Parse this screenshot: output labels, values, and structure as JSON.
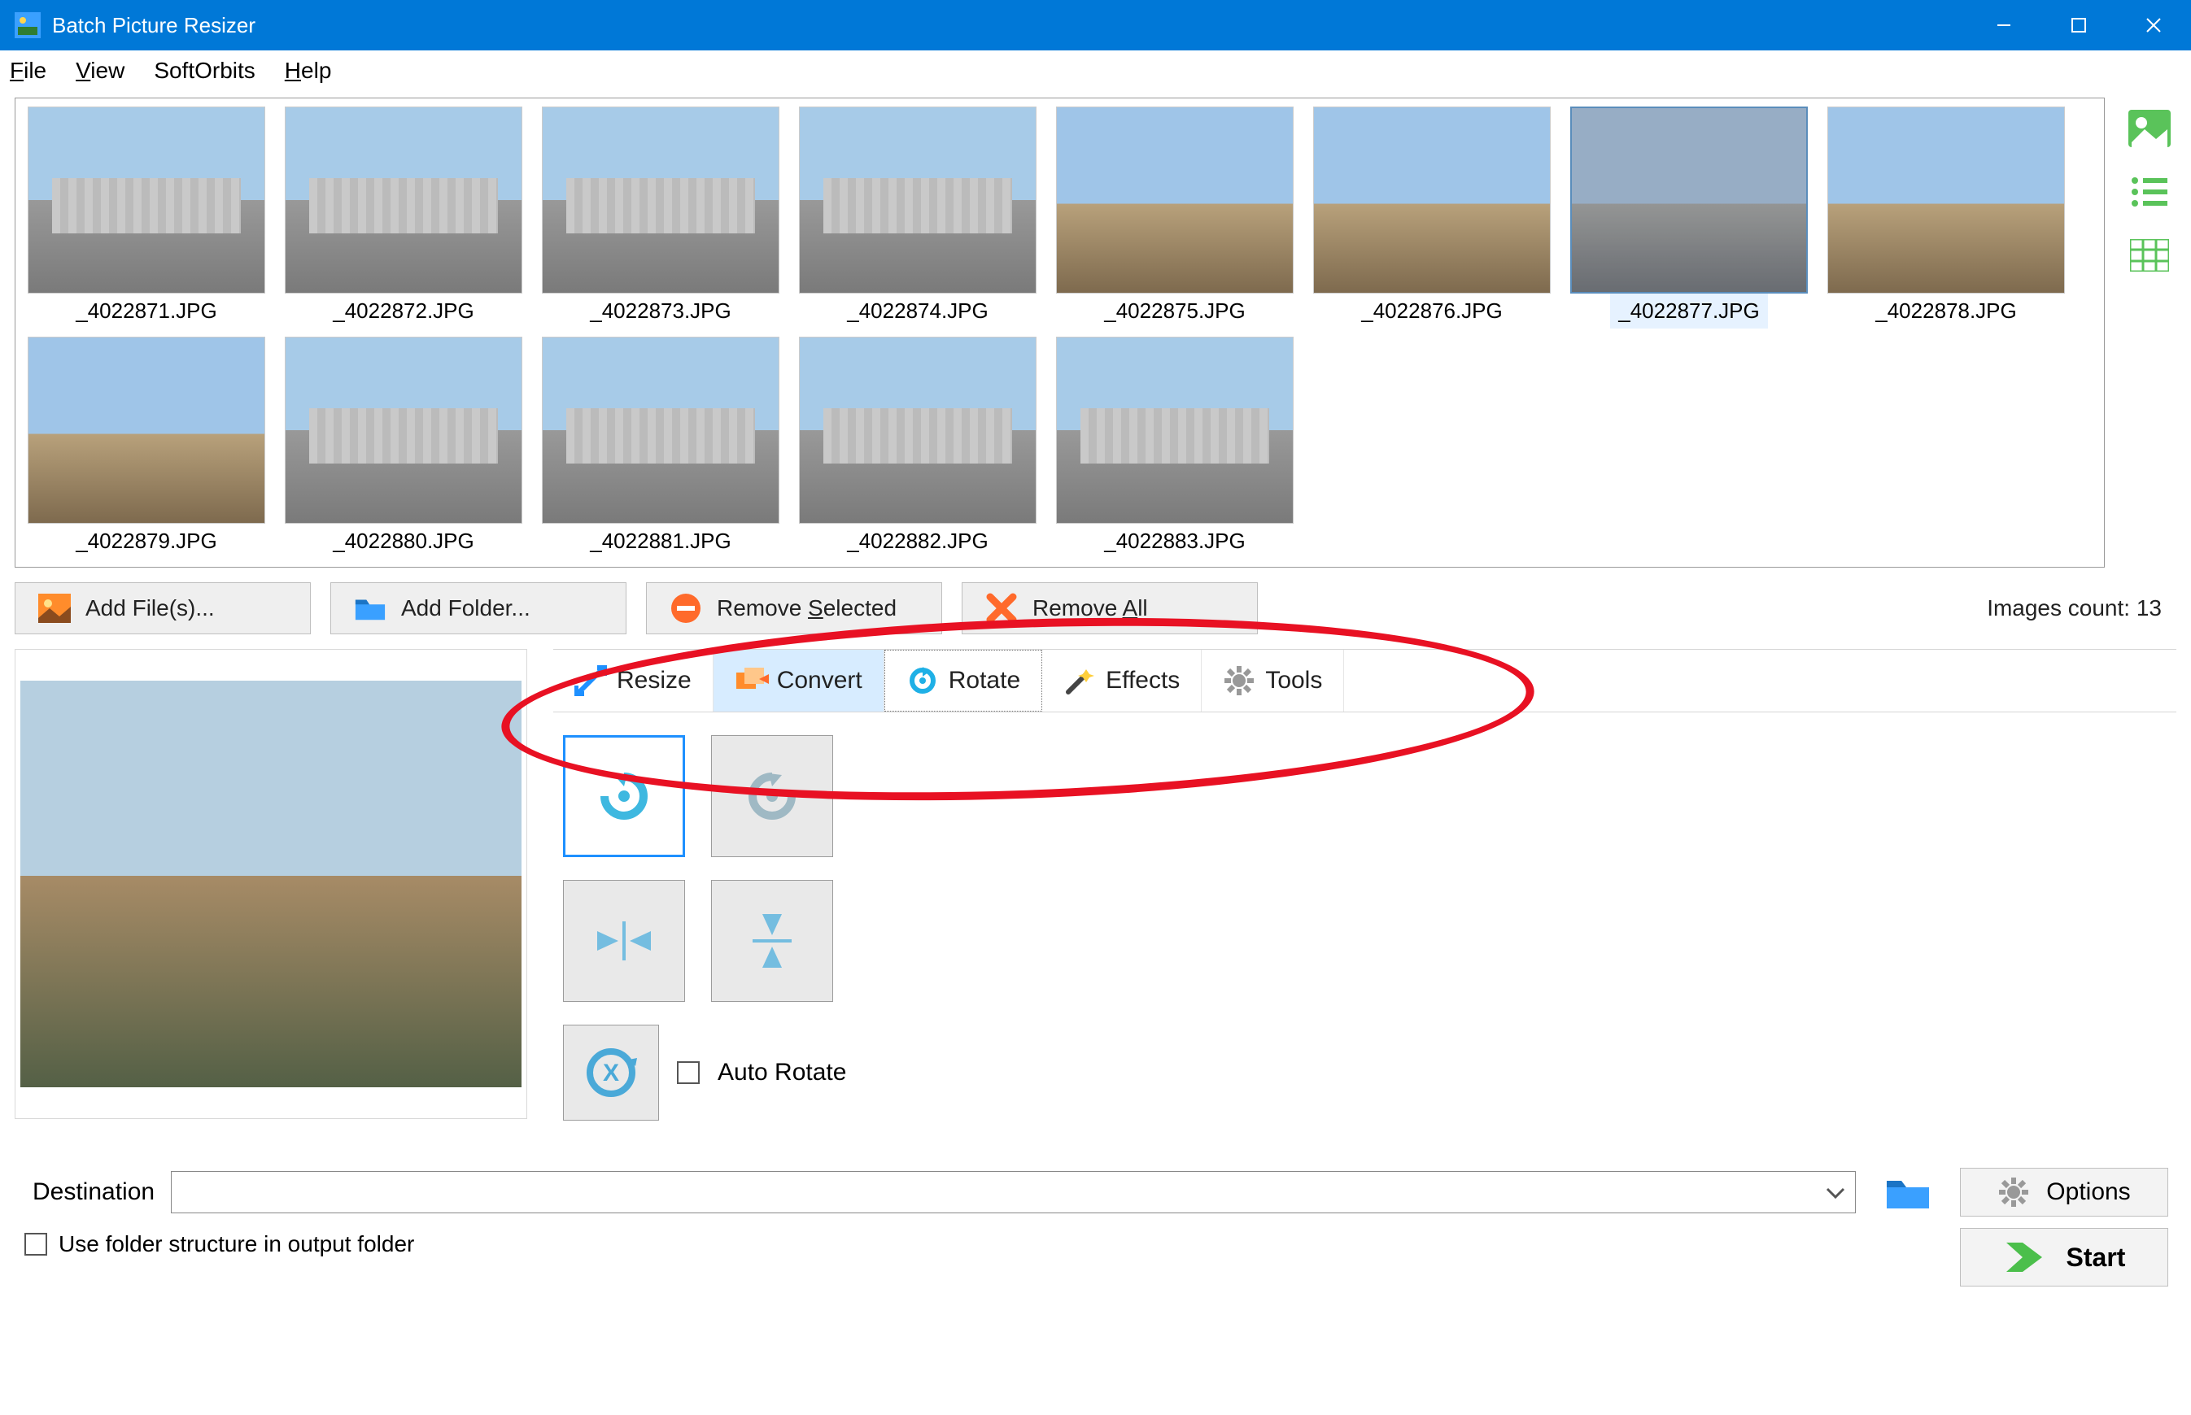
{
  "window": {
    "title": "Batch Picture Resizer"
  },
  "menu": {
    "file": "File",
    "view": "View",
    "softorbits": "SoftOrbits",
    "help": "Help"
  },
  "gallery": {
    "items": [
      {
        "name": "_4022871.JPG"
      },
      {
        "name": "_4022872.JPG"
      },
      {
        "name": "_4022873.JPG"
      },
      {
        "name": "_4022874.JPG"
      },
      {
        "name": "_4022875.JPG"
      },
      {
        "name": "_4022876.JPG"
      },
      {
        "name": "_4022877.JPG"
      },
      {
        "name": "_4022878.JPG"
      },
      {
        "name": "_4022879.JPG"
      },
      {
        "name": "_4022880.JPG"
      },
      {
        "name": "_4022881.JPG"
      },
      {
        "name": "_4022882.JPG"
      },
      {
        "name": "_4022883.JPG"
      }
    ],
    "selected_index": 6
  },
  "toolbar": {
    "add_files": "Add File(s)...",
    "add_folder": "Add Folder...",
    "remove_selected": "Remove Selected",
    "remove_all": "Remove All",
    "count_label": "Images count: 13"
  },
  "tabs": {
    "resize": "Resize",
    "convert": "Convert",
    "rotate": "Rotate",
    "effects": "Effects",
    "tools": "Tools",
    "active": "rotate"
  },
  "rotate_panel": {
    "auto_rotate": "Auto Rotate"
  },
  "destination": {
    "label": "Destination",
    "value": "",
    "options_btn": "Options",
    "use_folder_structure": "Use folder structure in output folder",
    "start": "Start"
  }
}
